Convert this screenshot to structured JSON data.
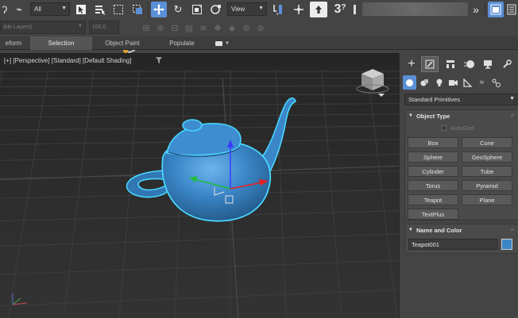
{
  "toolbar": {
    "selection_filter": "All",
    "reference_coordinate": "View",
    "help_icon_text": "3",
    "help_icon_question": "?"
  },
  "toolbar2": {
    "layer_field": "ible Layers)",
    "spinner_value": "100.0"
  },
  "ribbon": {
    "tabs": [
      {
        "label": "eform",
        "active": false
      },
      {
        "label": "Selection",
        "active": true
      },
      {
        "label": "Object Paint",
        "active": false
      },
      {
        "label": "Populate",
        "active": false
      }
    ]
  },
  "viewport": {
    "label": "[+] [Perspective] [Standard] [Default Shading]",
    "object_color": "#3a86c8",
    "selection_outline_color": "#48d6ff",
    "background_color": "#2a2a2a"
  },
  "command_panel": {
    "category": "Standard Primitives",
    "object_type": {
      "title": "Object Type",
      "autogrid_label": "AutoGrid",
      "buttons": [
        "Box",
        "Cone",
        "Sphere",
        "GeoSphere",
        "Cylinder",
        "Tube",
        "Torus",
        "Pyramid",
        "Teapot",
        "Plane",
        "TextPlus"
      ]
    },
    "name_and_color": {
      "title": "Name and Color",
      "object_name": "Teapot001",
      "color": "#3b86c6"
    }
  }
}
